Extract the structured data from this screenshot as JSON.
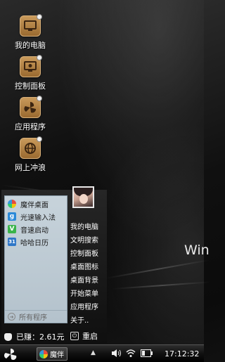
{
  "wallpaper": {
    "logo_text": "Win"
  },
  "desktop_icons": [
    {
      "label": "我的电脑"
    },
    {
      "label": "控制面板"
    },
    {
      "label": "应用程序"
    },
    {
      "label": "网上冲浪"
    }
  ],
  "start_menu": {
    "programs": [
      {
        "label": "魔伴桌面",
        "icon": "magic-desktop-icon",
        "color": "#3aa0e0"
      },
      {
        "label": "光速输入法",
        "icon": "input-method-icon",
        "color": "#2c8ad8"
      },
      {
        "label": "音速启动",
        "icon": "launcher-icon",
        "color": "#3ab44a"
      },
      {
        "label": "哈哈日历",
        "icon": "calendar-icon",
        "color": "#2f77c8"
      }
    ],
    "all_programs": "所有程序",
    "right_items": [
      "我的电脑",
      "文明搜索",
      "控制面板",
      "桌面图标",
      "桌面背景",
      "开始菜单",
      "应用程序",
      "关于.."
    ],
    "earned": "已赚：2.61元",
    "restart": "重启"
  },
  "taskbar": {
    "active_app": "魔伴",
    "clock": "17:12:32"
  }
}
